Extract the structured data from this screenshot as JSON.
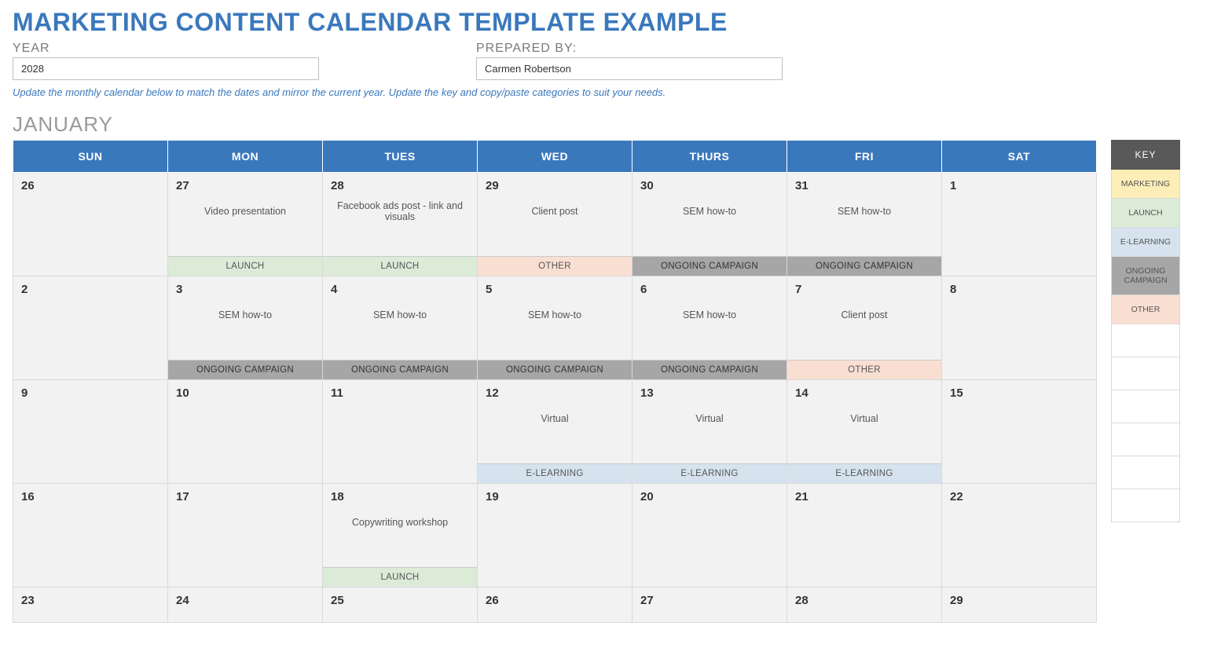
{
  "title": "MARKETING CONTENT CALENDAR TEMPLATE EXAMPLE",
  "meta": {
    "year_label": "YEAR",
    "year_value": "2028",
    "prepared_label": "PREPARED BY:",
    "prepared_value": "Carmen Robertson"
  },
  "helper": "Update the monthly calendar below to match the dates and mirror the current year. Update the key and copy/paste categories to suit your needs.",
  "month": "JANUARY",
  "day_headers": [
    "SUN",
    "MON",
    "TUES",
    "WED",
    "THURS",
    "FRI",
    "SAT"
  ],
  "key": {
    "header": "KEY",
    "items": [
      {
        "label": "MARKETING",
        "cls": "key-marketing"
      },
      {
        "label": "LAUNCH",
        "cls": "key-launch"
      },
      {
        "label": "E-LEARNING",
        "cls": "key-elearning"
      },
      {
        "label": "ONGOING CAMPAIGN",
        "cls": "key-ongoing"
      },
      {
        "label": "OTHER",
        "cls": "key-other"
      }
    ],
    "empties": 6
  },
  "weeks": [
    [
      {
        "num": "26"
      },
      {
        "num": "27",
        "desc": "Video presentation",
        "cat": "LAUNCH",
        "catcls": "cat-launch"
      },
      {
        "num": "28",
        "desc": "Facebook ads post - link and visuals",
        "cat": "LAUNCH",
        "catcls": "cat-launch"
      },
      {
        "num": "29",
        "desc": "Client post",
        "cat": "OTHER",
        "catcls": "cat-other"
      },
      {
        "num": "30",
        "desc": "SEM how-to",
        "cat": "ONGOING CAMPAIGN",
        "catcls": "cat-ongoing"
      },
      {
        "num": "31",
        "desc": "SEM how-to",
        "cat": "ONGOING CAMPAIGN",
        "catcls": "cat-ongoing"
      },
      {
        "num": "1"
      }
    ],
    [
      {
        "num": "2"
      },
      {
        "num": "3",
        "desc": "SEM how-to",
        "cat": "ONGOING CAMPAIGN",
        "catcls": "cat-ongoing"
      },
      {
        "num": "4",
        "desc": "SEM how-to",
        "cat": "ONGOING CAMPAIGN",
        "catcls": "cat-ongoing"
      },
      {
        "num": "5",
        "desc": "SEM how-to",
        "cat": "ONGOING CAMPAIGN",
        "catcls": "cat-ongoing"
      },
      {
        "num": "6",
        "desc": "SEM how-to",
        "cat": "ONGOING CAMPAIGN",
        "catcls": "cat-ongoing"
      },
      {
        "num": "7",
        "desc": "Client post",
        "cat": "OTHER",
        "catcls": "cat-other"
      },
      {
        "num": "8"
      }
    ],
    [
      {
        "num": "9"
      },
      {
        "num": "10"
      },
      {
        "num": "11"
      },
      {
        "num": "12",
        "desc": "Virtual",
        "cat": "E-LEARNING",
        "catcls": "cat-elearning"
      },
      {
        "num": "13",
        "desc": "Virtual",
        "cat": "E-LEARNING",
        "catcls": "cat-elearning"
      },
      {
        "num": "14",
        "desc": "Virtual",
        "cat": "E-LEARNING",
        "catcls": "cat-elearning"
      },
      {
        "num": "15"
      }
    ],
    [
      {
        "num": "16"
      },
      {
        "num": "17"
      },
      {
        "num": "18",
        "desc": "Copywriting workshop",
        "cat": "LAUNCH",
        "catcls": "cat-launch"
      },
      {
        "num": "19"
      },
      {
        "num": "20"
      },
      {
        "num": "21"
      },
      {
        "num": "22"
      }
    ],
    [
      {
        "num": "23"
      },
      {
        "num": "24"
      },
      {
        "num": "25"
      },
      {
        "num": "26"
      },
      {
        "num": "27"
      },
      {
        "num": "28"
      },
      {
        "num": "29"
      }
    ]
  ]
}
